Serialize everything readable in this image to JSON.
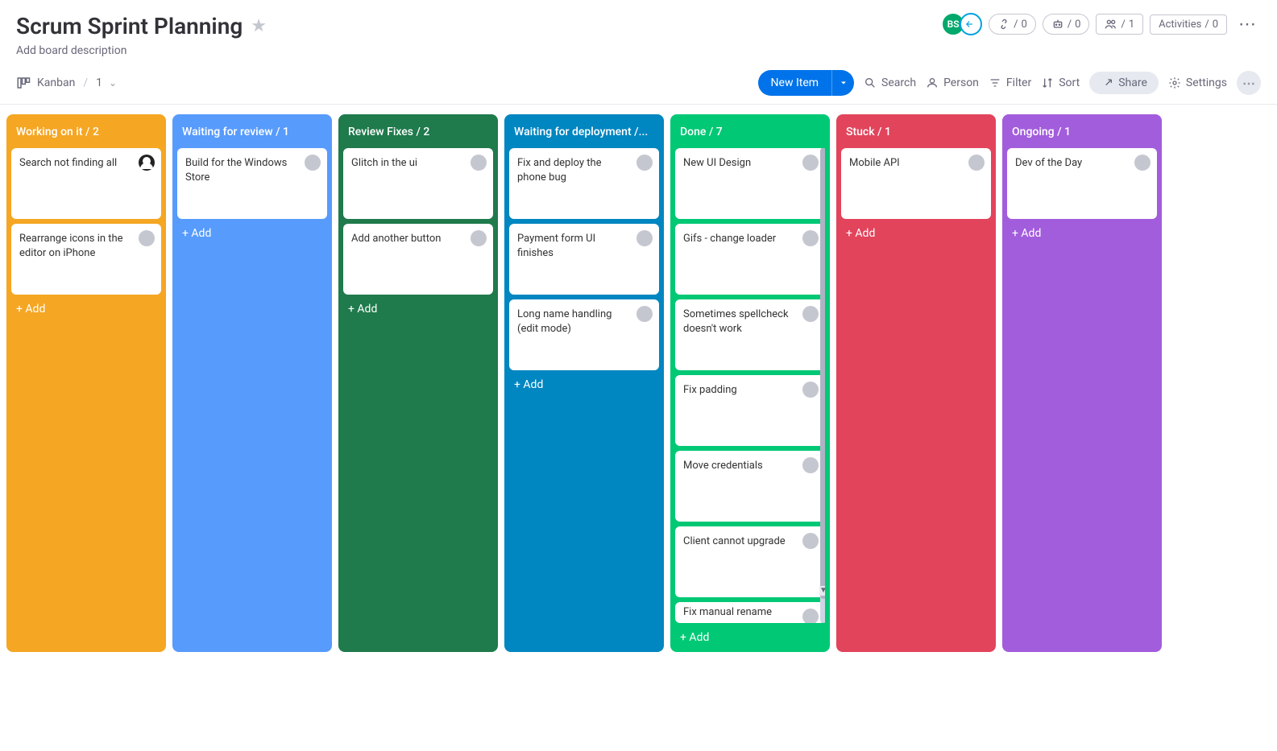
{
  "board": {
    "title": "Scrum Sprint Planning",
    "description_placeholder": "Add board description"
  },
  "header_right": {
    "avatar_bs": "BS",
    "integrations_count": "0",
    "automations_count": "0",
    "members_count": "1",
    "activities_label": "Activities",
    "activities_count": "0"
  },
  "view": {
    "name": "Kanban",
    "count": "1"
  },
  "toolbar": {
    "new_item": "New Item",
    "search": "Search",
    "person": "Person",
    "filter": "Filter",
    "sort": "Sort",
    "share": "Share",
    "settings": "Settings"
  },
  "columns": [
    {
      "id": "working",
      "color": "c-orange",
      "name": "Working on it",
      "count": "2",
      "cards": [
        {
          "title": "Search not finding all",
          "avatar": "img"
        },
        {
          "title": "Rearrange icons in the editor on iPhone",
          "avatar": "blank"
        }
      ],
      "add": "+ Add"
    },
    {
      "id": "waiting-review",
      "color": "c-blue",
      "name": "Waiting for review",
      "count": "1",
      "cards": [
        {
          "title": "Build for the Windows Store",
          "avatar": "blank"
        }
      ],
      "add": "+ Add"
    },
    {
      "id": "review-fixes",
      "color": "c-green",
      "name": "Review Fixes",
      "count": "2",
      "cards": [
        {
          "title": "Glitch in the ui",
          "avatar": "blank"
        },
        {
          "title": "Add another button",
          "avatar": "blank"
        }
      ],
      "add": "+ Add"
    },
    {
      "id": "waiting-deploy",
      "color": "c-teal",
      "name": "Waiting for deployment /...",
      "count": "",
      "cards": [
        {
          "title": "Fix and deploy the phone bug",
          "avatar": "blank"
        },
        {
          "title": "Payment form UI finishes",
          "avatar": "blank"
        },
        {
          "title": "Long name handling (edit mode)",
          "avatar": "blank"
        }
      ],
      "add": "+ Add"
    },
    {
      "id": "done",
      "color": "c-mint",
      "name": "Done",
      "count": "7",
      "cards": [
        {
          "title": "New UI Design",
          "avatar": "blank"
        },
        {
          "title": "Gifs - change loader",
          "avatar": "blank"
        },
        {
          "title": "Sometimes spellcheck doesn't work",
          "avatar": "blank"
        },
        {
          "title": "Fix padding",
          "avatar": "blank"
        },
        {
          "title": "Move credentials",
          "avatar": "blank"
        },
        {
          "title": "Client cannot upgrade",
          "avatar": "blank"
        },
        {
          "title": "Fix manual rename",
          "avatar": "blank"
        }
      ],
      "add": "+ Add",
      "scroll": true
    },
    {
      "id": "stuck",
      "color": "c-red",
      "name": "Stuck",
      "count": "1",
      "cards": [
        {
          "title": "Mobile API",
          "avatar": "blank"
        }
      ],
      "add": "+ Add"
    },
    {
      "id": "ongoing",
      "color": "c-purple",
      "name": "Ongoing",
      "count": "1",
      "cards": [
        {
          "title": "Dev of the Day",
          "avatar": "blank"
        }
      ],
      "add": "+ Add"
    }
  ]
}
